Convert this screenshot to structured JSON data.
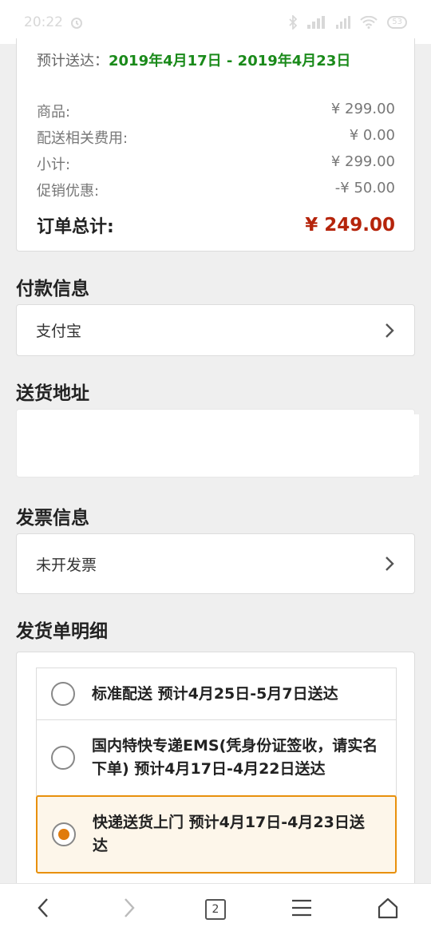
{
  "status_bar": {
    "time": "20:22",
    "battery": "53"
  },
  "delivery": {
    "label": "预计送达：",
    "range": "2019年4月17日 - 2019年4月23日"
  },
  "summary": {
    "rows": [
      {
        "label": "商品:",
        "value": "¥ 299.00"
      },
      {
        "label": "配送相关费用:",
        "value": "¥ 0.00"
      },
      {
        "label": "小计:",
        "value": "¥ 299.00"
      },
      {
        "label": "促销优惠:",
        "value": "-¥ 50.00"
      }
    ],
    "total_label": "订单总计:",
    "total_value": "¥ 249.00"
  },
  "payment": {
    "title": "付款信息",
    "method": "支付宝"
  },
  "address": {
    "title": "送货地址"
  },
  "invoice": {
    "title": "发票信息",
    "status": "未开发票"
  },
  "shipping": {
    "title": "发货单明细",
    "options": [
      {
        "label": "标准配送 预计4月25日-5月7日送达",
        "selected": false
      },
      {
        "label": "国内特快专递EMS(凭身份证签收，请实名下单) 预计4月17日-4月22日送达",
        "selected": false
      },
      {
        "label": "快递送货上门 预计4月17日-4月23日送达",
        "selected": true
      }
    ]
  },
  "nav": {
    "tab_count": "2"
  },
  "colors": {
    "accent": "#e8900c",
    "price_red": "#b5240b",
    "date_green": "#1a8a1a"
  }
}
